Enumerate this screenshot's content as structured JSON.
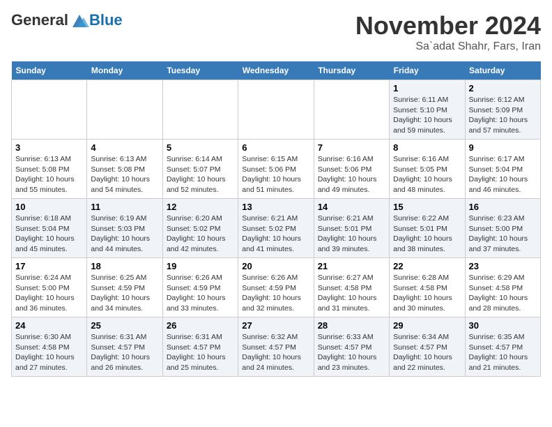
{
  "header": {
    "logo_general": "General",
    "logo_blue": "Blue",
    "title": "November 2024",
    "subtitle": "Sa`adat Shahr, Fars, Iran"
  },
  "weekdays": [
    "Sunday",
    "Monday",
    "Tuesday",
    "Wednesday",
    "Thursday",
    "Friday",
    "Saturday"
  ],
  "weeks": [
    [
      {
        "day": "",
        "info": ""
      },
      {
        "day": "",
        "info": ""
      },
      {
        "day": "",
        "info": ""
      },
      {
        "day": "",
        "info": ""
      },
      {
        "day": "",
        "info": ""
      },
      {
        "day": "1",
        "info": "Sunrise: 6:11 AM\nSunset: 5:10 PM\nDaylight: 10 hours and 59 minutes."
      },
      {
        "day": "2",
        "info": "Sunrise: 6:12 AM\nSunset: 5:09 PM\nDaylight: 10 hours and 57 minutes."
      }
    ],
    [
      {
        "day": "3",
        "info": "Sunrise: 6:13 AM\nSunset: 5:08 PM\nDaylight: 10 hours and 55 minutes."
      },
      {
        "day": "4",
        "info": "Sunrise: 6:13 AM\nSunset: 5:08 PM\nDaylight: 10 hours and 54 minutes."
      },
      {
        "day": "5",
        "info": "Sunrise: 6:14 AM\nSunset: 5:07 PM\nDaylight: 10 hours and 52 minutes."
      },
      {
        "day": "6",
        "info": "Sunrise: 6:15 AM\nSunset: 5:06 PM\nDaylight: 10 hours and 51 minutes."
      },
      {
        "day": "7",
        "info": "Sunrise: 6:16 AM\nSunset: 5:06 PM\nDaylight: 10 hours and 49 minutes."
      },
      {
        "day": "8",
        "info": "Sunrise: 6:16 AM\nSunset: 5:05 PM\nDaylight: 10 hours and 48 minutes."
      },
      {
        "day": "9",
        "info": "Sunrise: 6:17 AM\nSunset: 5:04 PM\nDaylight: 10 hours and 46 minutes."
      }
    ],
    [
      {
        "day": "10",
        "info": "Sunrise: 6:18 AM\nSunset: 5:04 PM\nDaylight: 10 hours and 45 minutes."
      },
      {
        "day": "11",
        "info": "Sunrise: 6:19 AM\nSunset: 5:03 PM\nDaylight: 10 hours and 44 minutes."
      },
      {
        "day": "12",
        "info": "Sunrise: 6:20 AM\nSunset: 5:02 PM\nDaylight: 10 hours and 42 minutes."
      },
      {
        "day": "13",
        "info": "Sunrise: 6:21 AM\nSunset: 5:02 PM\nDaylight: 10 hours and 41 minutes."
      },
      {
        "day": "14",
        "info": "Sunrise: 6:21 AM\nSunset: 5:01 PM\nDaylight: 10 hours and 39 minutes."
      },
      {
        "day": "15",
        "info": "Sunrise: 6:22 AM\nSunset: 5:01 PM\nDaylight: 10 hours and 38 minutes."
      },
      {
        "day": "16",
        "info": "Sunrise: 6:23 AM\nSunset: 5:00 PM\nDaylight: 10 hours and 37 minutes."
      }
    ],
    [
      {
        "day": "17",
        "info": "Sunrise: 6:24 AM\nSunset: 5:00 PM\nDaylight: 10 hours and 36 minutes."
      },
      {
        "day": "18",
        "info": "Sunrise: 6:25 AM\nSunset: 4:59 PM\nDaylight: 10 hours and 34 minutes."
      },
      {
        "day": "19",
        "info": "Sunrise: 6:26 AM\nSunset: 4:59 PM\nDaylight: 10 hours and 33 minutes."
      },
      {
        "day": "20",
        "info": "Sunrise: 6:26 AM\nSunset: 4:59 PM\nDaylight: 10 hours and 32 minutes."
      },
      {
        "day": "21",
        "info": "Sunrise: 6:27 AM\nSunset: 4:58 PM\nDaylight: 10 hours and 31 minutes."
      },
      {
        "day": "22",
        "info": "Sunrise: 6:28 AM\nSunset: 4:58 PM\nDaylight: 10 hours and 30 minutes."
      },
      {
        "day": "23",
        "info": "Sunrise: 6:29 AM\nSunset: 4:58 PM\nDaylight: 10 hours and 28 minutes."
      }
    ],
    [
      {
        "day": "24",
        "info": "Sunrise: 6:30 AM\nSunset: 4:58 PM\nDaylight: 10 hours and 27 minutes."
      },
      {
        "day": "25",
        "info": "Sunrise: 6:31 AM\nSunset: 4:57 PM\nDaylight: 10 hours and 26 minutes."
      },
      {
        "day": "26",
        "info": "Sunrise: 6:31 AM\nSunset: 4:57 PM\nDaylight: 10 hours and 25 minutes."
      },
      {
        "day": "27",
        "info": "Sunrise: 6:32 AM\nSunset: 4:57 PM\nDaylight: 10 hours and 24 minutes."
      },
      {
        "day": "28",
        "info": "Sunrise: 6:33 AM\nSunset: 4:57 PM\nDaylight: 10 hours and 23 minutes."
      },
      {
        "day": "29",
        "info": "Sunrise: 6:34 AM\nSunset: 4:57 PM\nDaylight: 10 hours and 22 minutes."
      },
      {
        "day": "30",
        "info": "Sunrise: 6:35 AM\nSunset: 4:57 PM\nDaylight: 10 hours and 21 minutes."
      }
    ]
  ]
}
